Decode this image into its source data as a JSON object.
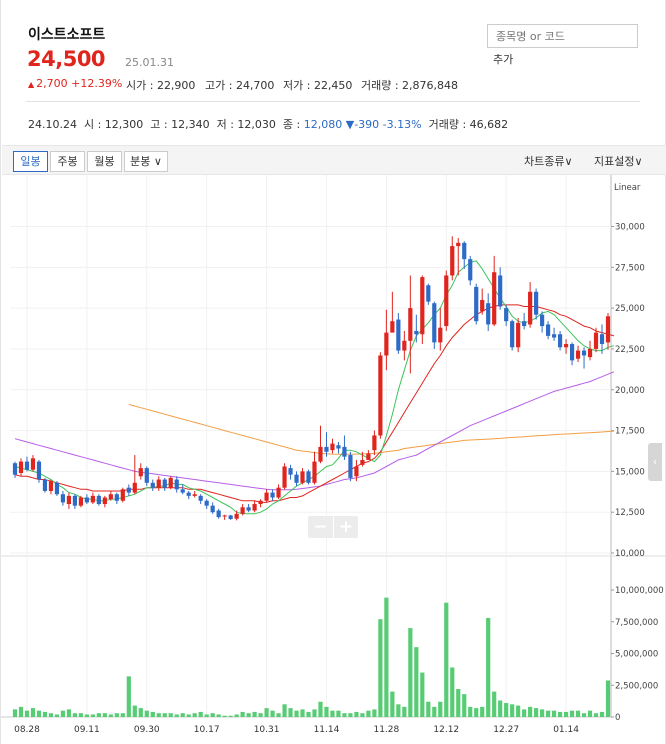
{
  "stock": {
    "name": "이스트소프트",
    "price": "24,500",
    "date": "25.01.31",
    "change": "2,700",
    "change_pct": "+12.39%",
    "open": "시가 : 22,900",
    "high": "고가 : 24,700",
    "low": "저가 : 22,450",
    "volume": "거래량 : 2,876,848"
  },
  "search": {
    "placeholder": "종목명 or 코드",
    "add_label": "추가"
  },
  "prev": {
    "date": "24.10.24",
    "open": "시 : 12,300",
    "high": "고 : 12,340",
    "low": "저 : 12,030",
    "close_label": "종 :",
    "close": "12,080",
    "diff": "▼-390 -3.13%",
    "volume": "거래량 : 46,682"
  },
  "toolbar": {
    "tabs": [
      "일봉",
      "주봉",
      "월봉",
      "분봉"
    ],
    "active_tab": "일봉",
    "chart_type": "차트종류",
    "indicator": "지표설정"
  },
  "colors": {
    "up": "#e0251f",
    "down": "#2d6bc7",
    "ma5": "#3cc35a",
    "ma20": "#e0251f",
    "ma60": "#b65ee8",
    "ma120": "#f29f45",
    "volume": "#58cc74"
  },
  "chart_data": {
    "type": "candlestick",
    "scale_label": "Linear",
    "price_ticks": [
      10000,
      12500,
      15000,
      17500,
      20000,
      22500,
      25000,
      27500,
      30000
    ],
    "volume_ticks": [
      0,
      2500000,
      5000000,
      7500000,
      10000000
    ],
    "price_tick_labels": [
      "10,000",
      "12,500",
      "15,000",
      "17,500",
      "20,000",
      "22,500",
      "25,000",
      "27,500",
      "30,000"
    ],
    "volume_tick_labels": [
      "0",
      "2,500,000",
      "5,000,000",
      "7,500,000",
      "10,000,000"
    ],
    "x_labels": [
      {
        "label": "08.28",
        "index": 2
      },
      {
        "label": "09.11",
        "index": 12
      },
      {
        "label": "09.30",
        "index": 22
      },
      {
        "label": "10.17",
        "index": 32
      },
      {
        "label": "10.31",
        "index": 42
      },
      {
        "label": "11.14",
        "index": 52
      },
      {
        "label": "11.28",
        "index": 62
      },
      {
        "label": "12.12",
        "index": 72
      },
      {
        "label": "12.27",
        "index": 82
      },
      {
        "label": "01.14",
        "index": 92
      }
    ],
    "candles": [
      [
        15500,
        14800,
        15600,
        14600,
        600000
      ],
      [
        14900,
        15600,
        15800,
        14700,
        800000
      ],
      [
        15600,
        15100,
        15900,
        15000,
        500000
      ],
      [
        15100,
        15800,
        16000,
        15000,
        700000
      ],
      [
        15600,
        14500,
        15700,
        14300,
        500000
      ],
      [
        14500,
        13800,
        14600,
        13700,
        400000
      ],
      [
        13800,
        14400,
        14500,
        13600,
        300000
      ],
      [
        14300,
        13600,
        14400,
        13500,
        200000
      ],
      [
        13600,
        13100,
        13800,
        12900,
        500000
      ],
      [
        13000,
        13500,
        13700,
        12700,
        600000
      ],
      [
        13500,
        12900,
        13600,
        12700,
        300000
      ],
      [
        12900,
        13400,
        13500,
        12800,
        300000
      ],
      [
        13400,
        13100,
        13600,
        13000,
        200000
      ],
      [
        13100,
        13500,
        13700,
        13000,
        200000
      ],
      [
        13500,
        13000,
        13600,
        12900,
        300000
      ],
      [
        13000,
        13400,
        13500,
        12800,
        300000
      ],
      [
        13300,
        13600,
        13800,
        13200,
        200000
      ],
      [
        13600,
        13200,
        13700,
        13000,
        300000
      ],
      [
        13200,
        13900,
        14000,
        13100,
        300000
      ],
      [
        14000,
        13700,
        14200,
        13500,
        3200000
      ],
      [
        13700,
        14300,
        16000,
        13600,
        900000
      ],
      [
        14700,
        15200,
        15500,
        14500,
        700000
      ],
      [
        15200,
        14300,
        15300,
        14100,
        500000
      ],
      [
        14300,
        14000,
        14500,
        13800,
        400000
      ],
      [
        14000,
        14500,
        14700,
        13800,
        300000
      ],
      [
        14500,
        14000,
        14600,
        13800,
        300000
      ],
      [
        14000,
        14600,
        14700,
        13900,
        300000
      ],
      [
        14500,
        13900,
        14700,
        13700,
        200000
      ],
      [
        13900,
        13700,
        14200,
        13600,
        300000
      ],
      [
        13700,
        13500,
        13800,
        13300,
        200000
      ],
      [
        13500,
        13600,
        13800,
        13400,
        300000
      ],
      [
        13500,
        13200,
        13600,
        13000,
        400000
      ],
      [
        13200,
        12900,
        13300,
        12700,
        200000
      ],
      [
        12900,
        12500,
        13100,
        12400,
        300000
      ],
      [
        12600,
        12200,
        12700,
        12100,
        200000
      ],
      [
        12300,
        12300,
        12340,
        12030,
        100000
      ],
      [
        12300,
        12080,
        12340,
        12030,
        100000
      ],
      [
        12100,
        12400,
        12600,
        12000,
        200000
      ],
      [
        12400,
        12800,
        13000,
        12300,
        400000
      ],
      [
        12800,
        12600,
        13000,
        12500,
        300000
      ],
      [
        12600,
        13000,
        13200,
        12500,
        400000
      ],
      [
        13000,
        13200,
        13300,
        12800,
        300000
      ],
      [
        13200,
        13700,
        13900,
        13100,
        700000
      ],
      [
        13700,
        13400,
        13900,
        13200,
        500000
      ],
      [
        13400,
        14000,
        14200,
        13300,
        300000
      ],
      [
        14000,
        15300,
        15500,
        13900,
        1000000
      ],
      [
        15200,
        14800,
        15400,
        14500,
        700000
      ],
      [
        14800,
        14300,
        15000,
        14100,
        500000
      ],
      [
        14300,
        15000,
        15200,
        14200,
        600000
      ],
      [
        15000,
        14300,
        15100,
        14200,
        400000
      ],
      [
        14300,
        15600,
        16200,
        14200,
        600000
      ],
      [
        15600,
        16500,
        17800,
        15500,
        1200000
      ],
      [
        16500,
        16200,
        17400,
        15900,
        800000
      ],
      [
        16300,
        16700,
        17000,
        16100,
        500000
      ],
      [
        16600,
        16400,
        16800,
        16100,
        500000
      ],
      [
        16500,
        15900,
        17200,
        15700,
        300000
      ],
      [
        16000,
        14600,
        16200,
        14400,
        300000
      ],
      [
        14700,
        15300,
        15700,
        14400,
        400000
      ],
      [
        15400,
        15700,
        16200,
        15300,
        300000
      ],
      [
        15700,
        16100,
        16300,
        15800,
        500000
      ],
      [
        16300,
        17200,
        17500,
        16000,
        600000
      ],
      [
        17200,
        22100,
        22300,
        17000,
        7700000
      ],
      [
        22100,
        23500,
        24900,
        21200,
        9400000
      ],
      [
        23500,
        24200,
        26000,
        23600,
        2000000
      ],
      [
        24300,
        22400,
        24700,
        22200,
        1000000
      ],
      [
        22400,
        23000,
        23600,
        21800,
        800000
      ],
      [
        23000,
        25000,
        27000,
        21000,
        7000000
      ],
      [
        23600,
        23400,
        24600,
        22900,
        5500000
      ],
      [
        23400,
        26900,
        27000,
        22800,
        3500000
      ],
      [
        26400,
        25400,
        26500,
        25200,
        1200000
      ],
      [
        25300,
        22900,
        25400,
        22500,
        800000
      ],
      [
        22900,
        23800,
        25000,
        22400,
        1200000
      ],
      [
        23900,
        27000,
        27300,
        23600,
        9000000
      ],
      [
        27000,
        28800,
        29400,
        26700,
        3900000
      ],
      [
        28800,
        29000,
        29300,
        27000,
        2200000
      ],
      [
        29000,
        28000,
        29100,
        27400,
        1800000
      ],
      [
        28000,
        26700,
        28200,
        26400,
        800000
      ],
      [
        26300,
        24200,
        26500,
        24000,
        700000
      ],
      [
        24800,
        25500,
        26200,
        24600,
        800000
      ],
      [
        25300,
        24000,
        25900,
        23600,
        7800000
      ],
      [
        24000,
        27200,
        28200,
        23900,
        2000000
      ],
      [
        27000,
        25100,
        27500,
        24900,
        1300000
      ],
      [
        25000,
        24200,
        25200,
        23900,
        1100000
      ],
      [
        24200,
        22600,
        24300,
        22400,
        1000000
      ],
      [
        22600,
        24100,
        24400,
        22300,
        900000
      ],
      [
        24200,
        23900,
        24700,
        23700,
        600000
      ],
      [
        24000,
        26000,
        26600,
        23800,
        800000
      ],
      [
        26000,
        24600,
        26200,
        24300,
        700000
      ],
      [
        24600,
        23900,
        24800,
        23500,
        600000
      ],
      [
        24000,
        23300,
        24200,
        23100,
        500000
      ],
      [
        23400,
        23200,
        23800,
        23000,
        500000
      ],
      [
        23400,
        22600,
        23600,
        22400,
        400000
      ],
      [
        22600,
        22800,
        23100,
        22200,
        400000
      ],
      [
        22800,
        21800,
        22900,
        21500,
        500000
      ],
      [
        21900,
        22400,
        22700,
        21700,
        500000
      ],
      [
        22400,
        22100,
        22600,
        21300,
        300000
      ],
      [
        22000,
        22500,
        23000,
        21800,
        500000
      ],
      [
        22500,
        23500,
        23800,
        22300,
        300000
      ],
      [
        23400,
        22800,
        24000,
        22200,
        400000
      ],
      [
        22900,
        24500,
        24700,
        22450,
        2876848
      ]
    ],
    "ma5": [
      15300,
      15200,
      15100,
      15000,
      14900,
      14700,
      14500,
      14200,
      14000,
      13700,
      13600,
      13400,
      13300,
      13300,
      13200,
      13200,
      13300,
      13300,
      13400,
      13500,
      13600,
      13800,
      14000,
      14000,
      14100,
      14100,
      14300,
      14200,
      14200,
      14000,
      13900,
      13800,
      13600,
      13400,
      13200,
      13000,
      12800,
      12500,
      12400,
      12400,
      12400,
      12500,
      12700,
      13000,
      13200,
      13500,
      13800,
      14100,
      14300,
      14500,
      14700,
      15000,
      15300,
      15400,
      15800,
      16300,
      16300,
      16200,
      16000,
      15800,
      15600,
      16000,
      17200,
      18500,
      20000,
      21200,
      22400,
      23300,
      23700,
      24100,
      24600,
      25000,
      25800,
      26400,
      27200,
      27500,
      27800,
      27900,
      27400,
      26800,
      26200,
      25600,
      25100,
      24500,
      24200,
      24100,
      24200,
      24400,
      24700,
      24800,
      24600,
      24200,
      23800,
      23400,
      23000,
      22700,
      22500,
      22400,
      22400,
      22600,
      22700
    ],
    "ma20": [
      14800,
      14700,
      14700,
      14600,
      14500,
      14500,
      14400,
      14300,
      14200,
      14100,
      14000,
      13900,
      13900,
      13800,
      13800,
      13800,
      13800,
      13800,
      13800,
      13900,
      13900,
      13900,
      14000,
      14000,
      14000,
      14000,
      14000,
      14000,
      14000,
      13900,
      13900,
      13900,
      13800,
      13700,
      13600,
      13500,
      13400,
      13300,
      13200,
      13200,
      13200,
      13100,
      13100,
      13200,
      13200,
      13300,
      13400,
      13400,
      13500,
      13700,
      13900,
      14100,
      14300,
      14500,
      14700,
      14900,
      15100,
      15300,
      15500,
      15600,
      15800,
      16200,
      16800,
      17400,
      18000,
      18600,
      19200,
      19800,
      20400,
      21000,
      21600,
      22100,
      22700,
      23200,
      23600,
      24000,
      24300,
      24600,
      24800,
      25000,
      25100,
      25200,
      25200,
      25200,
      25200,
      25100,
      25100,
      25100,
      25000,
      24900,
      24800,
      24600,
      24500,
      24300,
      24100,
      23900,
      23800,
      23600,
      23500,
      23400,
      23300
    ],
    "ma60": [
      17000,
      16900,
      16800,
      16700,
      16600,
      16500,
      16400,
      16300,
      16200,
      16100,
      16000,
      15900,
      15800,
      15700,
      15600,
      15500,
      15400,
      15300,
      15200,
      15100,
      15000,
      14950,
      14900,
      14850,
      14800,
      14750,
      14700,
      14650,
      14600,
      14550,
      14500,
      14450,
      14400,
      14350,
      14300,
      14250,
      14200,
      14150,
      14100,
      14050,
      14000,
      13950,
      13900,
      13880,
      13870,
      13870,
      13880,
      13900,
      13950,
      14000,
      14050,
      14100,
      14200,
      14300,
      14400,
      14500,
      14550,
      14600,
      14700,
      14800,
      14900,
      15100,
      15300,
      15500,
      15700,
      15800,
      15900,
      16000,
      16200,
      16400,
      16600,
      16800,
      17000,
      17200,
      17400,
      17600,
      17800,
      17950,
      18100,
      18250,
      18400,
      18550,
      18700,
      18850,
      19000,
      19150,
      19300,
      19450,
      19600,
      19750,
      19900,
      20000,
      20100,
      20200,
      20300,
      20400,
      20500,
      20650,
      20800,
      20950,
      21100
    ],
    "ma120_start_index": 19,
    "ma120": [
      19100,
      19000,
      18900,
      18800,
      18700,
      18600,
      18500,
      18400,
      18300,
      18200,
      18100,
      18000,
      17900,
      17800,
      17700,
      17600,
      17500,
      17400,
      17300,
      17200,
      17100,
      17000,
      16900,
      16800,
      16700,
      16600,
      16500,
      16400,
      16300,
      16250,
      16200,
      16150,
      16100,
      16080,
      16060,
      16050,
      16050,
      16050,
      16060,
      16070,
      16080,
      16100,
      16150,
      16200,
      16250,
      16300,
      16400,
      16450,
      16500,
      16550,
      16600,
      16650,
      16700,
      16750,
      16800,
      16850,
      16900,
      16920,
      16940,
      16960,
      16980,
      17000,
      17020,
      17050,
      17080,
      17100,
      17120,
      17150,
      17180,
      17200,
      17220,
      17250,
      17270,
      17290,
      17310,
      17330,
      17350,
      17370,
      17390,
      17410,
      17440,
      17470
    ]
  }
}
